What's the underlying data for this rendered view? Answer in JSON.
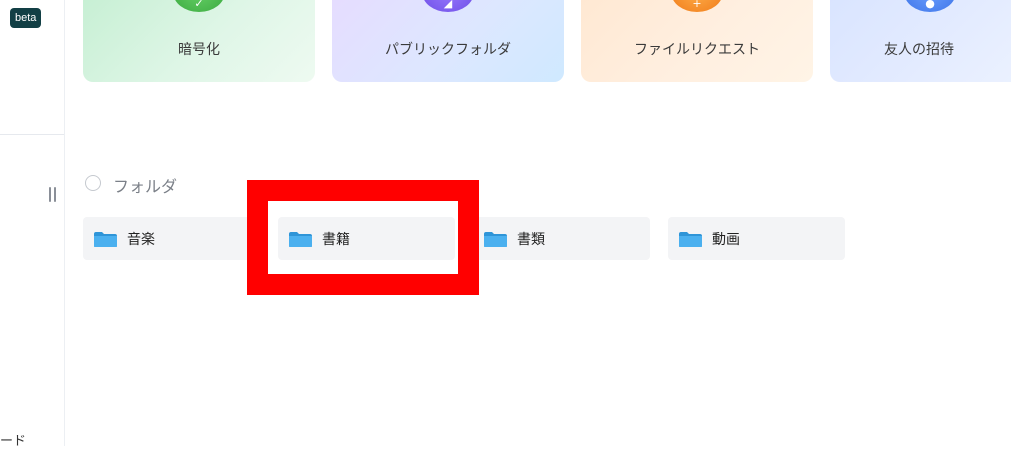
{
  "sidebar": {
    "badge": "beta",
    "bottom_text": "ード"
  },
  "feature_cards": [
    {
      "label": "暗号化",
      "icon": "shield-check-icon"
    },
    {
      "label": "パブリックフォルダ",
      "icon": "share-folder-icon"
    },
    {
      "label": "ファイルリクエスト",
      "icon": "file-request-icon"
    },
    {
      "label": "友人の招待",
      "icon": "invite-user-icon"
    }
  ],
  "folders_section": {
    "title": "フォルダ",
    "items": [
      {
        "name": "音楽",
        "icon": "folder-icon"
      },
      {
        "name": "書籍",
        "icon": "folder-icon"
      },
      {
        "name": "書類",
        "icon": "folder-icon"
      },
      {
        "name": "動画",
        "icon": "folder-icon"
      }
    ]
  },
  "colors": {
    "highlight": "#ff0000",
    "folder_icon": "#3ea6ea",
    "badge_bg": "#123f45"
  }
}
